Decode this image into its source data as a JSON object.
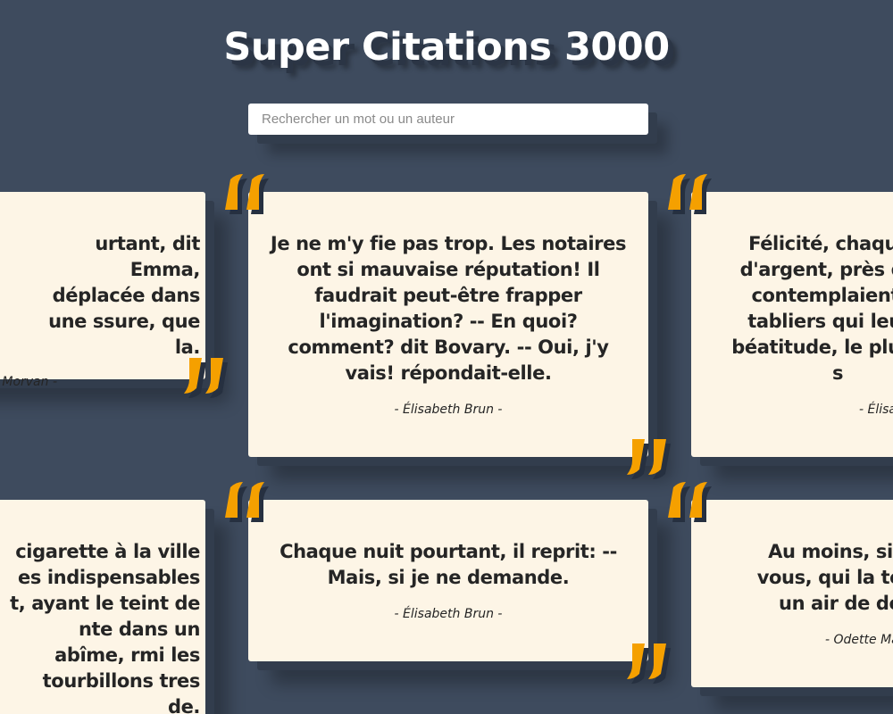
{
  "header": {
    "title": "Super Citations 3000"
  },
  "search": {
    "placeholder": "Rechercher un mot ou un auteur",
    "value": ""
  },
  "colors": {
    "background": "#3e4b5e",
    "card": "#fdf5e6",
    "quote_mark": "#f5a000",
    "text": "#252525"
  },
  "icons": {
    "open_quote": "open-quote-icon",
    "close_quote": "close-quote-icon"
  },
  "quotes": [
    {
      "text": "urtant, dit Emma, déplacée dans une ssure, que la.",
      "author": "Morvan -"
    },
    {
      "text": "Je ne m'y fie pas trop. Les notaires ont si mauvaise réputation! Il faudrait peut-être frapper l'imagination? -- En quoi? comment? dit Bovary. -- Oui, j'y vais! répondait-elle.",
      "author": "- Élisabeth Brun -"
    },
    {
      "text": "Félicité, chaque s d'argent, près d'un contemplaient la tabliers qui leur s béatitude, le plus un s",
      "author": "- Élisabe"
    },
    {
      "text": "cigarette à la ville es indispensables t, ayant le teint de nte dans un abîme, rmi les tourbillons tres de.",
      "author": ""
    },
    {
      "text": "Chaque nuit pourtant, il reprit: -- Mais, si je ne demande.",
      "author": "- Élisabeth Brun -"
    },
    {
      "text": "Au moins, si un vous, qui la termi un air de déd",
      "author": "- Odette Maillo"
    }
  ]
}
